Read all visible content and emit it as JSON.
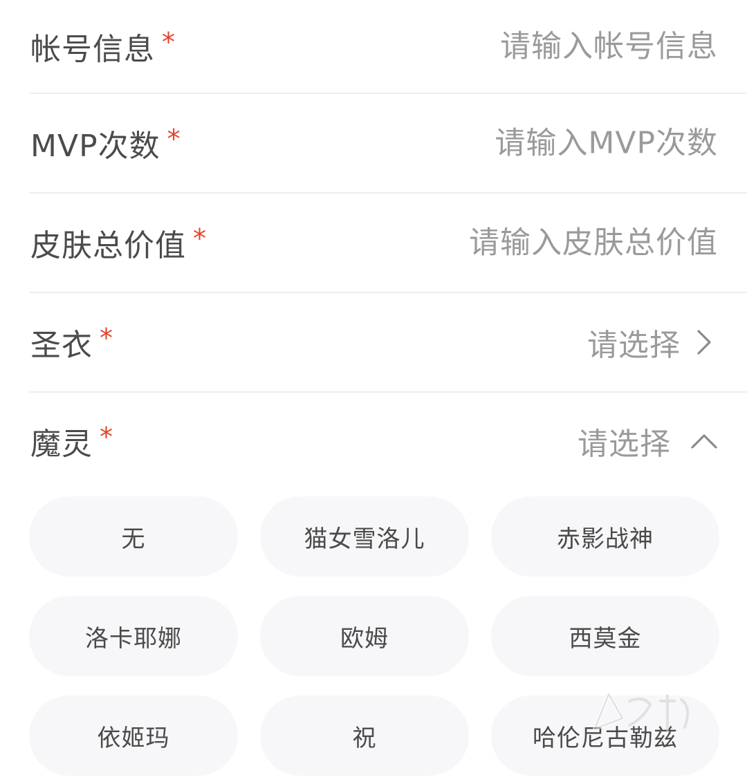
{
  "form": {
    "account": {
      "label": "帐号信息",
      "required_mark": "*",
      "placeholder": "请输入帐号信息",
      "value": ""
    },
    "mvp": {
      "label": "MVP次数",
      "required_mark": "*",
      "placeholder": "请输入MVP次数",
      "value": ""
    },
    "skin_value": {
      "label": "皮肤总价值",
      "required_mark": "*",
      "placeholder": "请输入皮肤总价值",
      "value": ""
    },
    "holy_cloth": {
      "label": "圣衣",
      "required_mark": "*",
      "select_text": "请选择",
      "icon": "chevron-right-icon"
    },
    "demon_spirit": {
      "label": "魔灵",
      "required_mark": "*",
      "select_text": "请选择",
      "icon": "chevron-up-icon",
      "options": [
        "无",
        "猫女雪洛儿",
        "赤影战神",
        "洛卡耶娜",
        "欧姆",
        "西莫金",
        "依姬玛",
        "祝",
        "哈伦尼古勒兹"
      ]
    }
  },
  "colors": {
    "required": "#e0452e",
    "placeholder": "#9a9a9a",
    "label": "#4b4b4b",
    "chip_bg": "#f7f7f9",
    "divider": "#eeeeee"
  }
}
